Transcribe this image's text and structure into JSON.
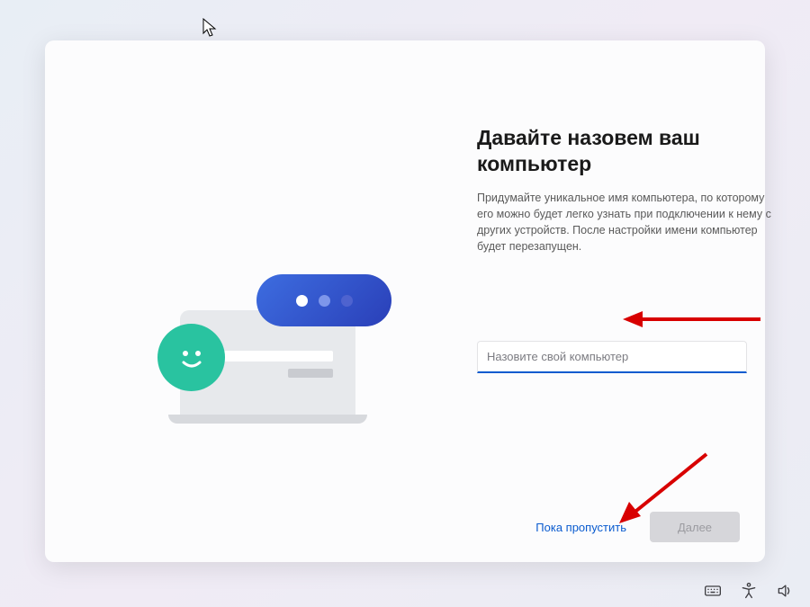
{
  "heading": "Давайте назовем ваш компьютер",
  "description": "Придумайте уникальное имя компьютера, по которому его можно будет легко узнать при подключении к нему с других устройств. После настройки имени компьютер будет перезапущен.",
  "input": {
    "placeholder": "Назовите свой компьютер",
    "value": ""
  },
  "buttons": {
    "skip": "Пока пропустить",
    "next": "Далее"
  }
}
